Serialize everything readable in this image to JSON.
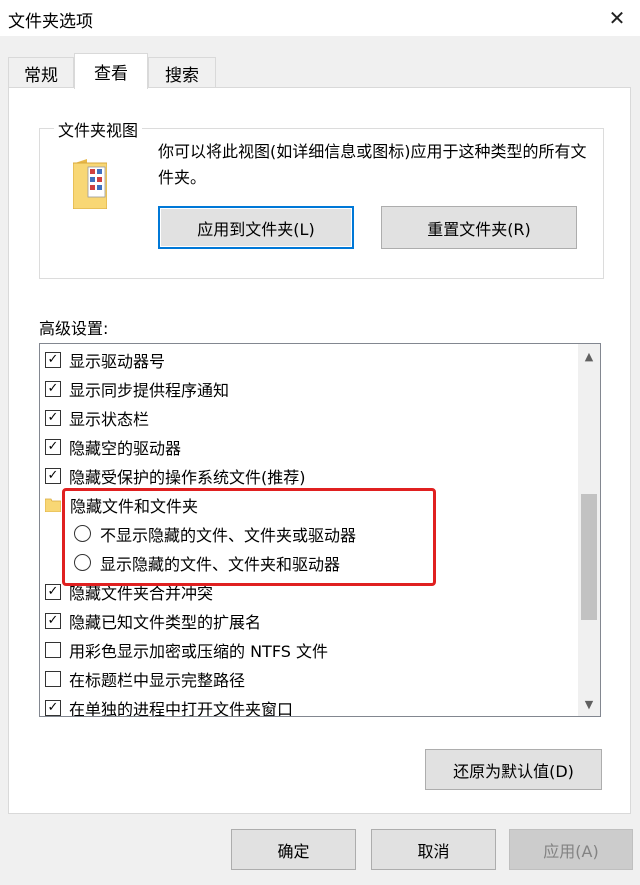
{
  "window": {
    "title": "文件夹选项",
    "close_glyph": "✕"
  },
  "tabs": [
    {
      "label": "常规",
      "active": false
    },
    {
      "label": "查看",
      "active": true
    },
    {
      "label": "搜索",
      "active": false
    }
  ],
  "folder_views": {
    "group_label": "文件夹视图",
    "description": "你可以将此视图(如详细信息或图标)应用于这种类型的所有文件夹。",
    "apply_button": "应用到文件夹(L)",
    "reset_button": "重置文件夹(R)"
  },
  "advanced": {
    "label": "高级设置:",
    "items": [
      {
        "type": "checkbox",
        "checked": true,
        "label": "显示驱动器号"
      },
      {
        "type": "checkbox",
        "checked": true,
        "label": "显示同步提供程序通知"
      },
      {
        "type": "checkbox",
        "checked": true,
        "label": "显示状态栏"
      },
      {
        "type": "checkbox",
        "checked": true,
        "label": "隐藏空的驱动器"
      },
      {
        "type": "checkbox",
        "checked": true,
        "label": "隐藏受保护的操作系统文件(推荐)"
      },
      {
        "type": "folder",
        "label": "隐藏文件和文件夹"
      },
      {
        "type": "radio",
        "checked": false,
        "label": "不显示隐藏的文件、文件夹或驱动器"
      },
      {
        "type": "radio",
        "checked": false,
        "label": "显示隐藏的文件、文件夹和驱动器"
      },
      {
        "type": "checkbox",
        "checked": true,
        "label": "隐藏文件夹合并冲突"
      },
      {
        "type": "checkbox",
        "checked": true,
        "label": "隐藏已知文件类型的扩展名"
      },
      {
        "type": "checkbox",
        "checked": false,
        "label": "用彩色显示加密或压缩的 NTFS 文件"
      },
      {
        "type": "checkbox",
        "checked": false,
        "label": "在标题栏中显示完整路径"
      },
      {
        "type": "checkbox",
        "checked": true,
        "label": "在单独的进程中打开文件夹窗口"
      }
    ],
    "check_glyph": "✓",
    "scroll_up_glyph": "▲",
    "scroll_down_glyph": "▼",
    "restore_button": "还原为默认值(D)"
  },
  "footer": {
    "ok_button": "确定",
    "cancel_button": "取消",
    "apply_button": "应用(A)"
  },
  "colors": {
    "highlight": "#e02020",
    "focus": "#0078d7",
    "folder": "#f8d775"
  }
}
